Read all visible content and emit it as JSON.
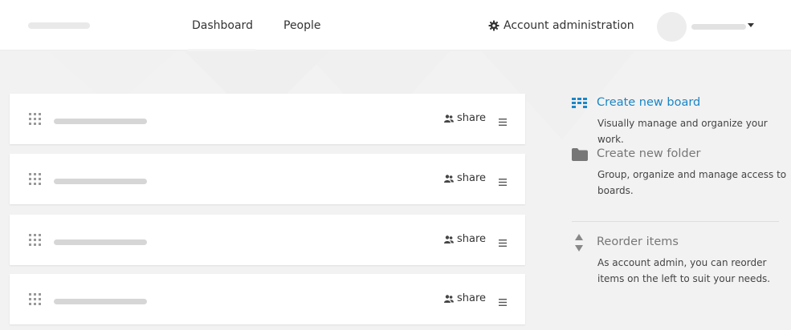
{
  "header": {
    "nav": {
      "dashboard": "Dashboard",
      "people": "People"
    },
    "account_admin_label": "Account administration",
    "account_admin_icon": "gear-icon"
  },
  "boards": [
    {
      "share_label": "share",
      "share_icon": "users-icon",
      "menu_icon": "hamburger-menu-icon",
      "drag_icon": "drag-handle-icon"
    },
    {
      "share_label": "share",
      "share_icon": "users-icon",
      "menu_icon": "hamburger-menu-icon",
      "drag_icon": "drag-handle-icon"
    },
    {
      "share_label": "share",
      "share_icon": "users-icon",
      "menu_icon": "hamburger-menu-icon",
      "drag_icon": "drag-handle-icon"
    },
    {
      "share_label": "share",
      "share_icon": "users-icon",
      "menu_icon": "hamburger-menu-icon",
      "drag_icon": "drag-handle-icon"
    }
  ],
  "sidebar": {
    "create_board": {
      "title": "Create new board",
      "description": "Visually manage and organize your work.",
      "icon": "board-icon"
    },
    "create_folder": {
      "title": "Create new folder",
      "description": "Group, organize and manage access to boards.",
      "icon": "folder-icon"
    },
    "reorder": {
      "title": "Reorder items",
      "description": "As account admin, you can reorder items on the left to suit your needs.",
      "icon": "sort-arrows-icon"
    }
  },
  "colors": {
    "accent": "#1a86c6",
    "background": "#f2f2f2",
    "card": "#ffffff",
    "placeholder": "#d6d6d6"
  }
}
